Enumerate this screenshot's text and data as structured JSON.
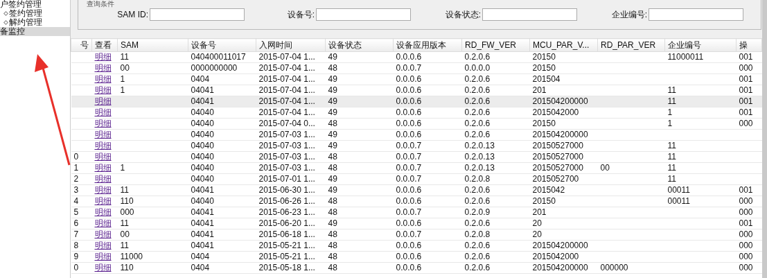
{
  "sidebar": {
    "items": [
      {
        "label": "户签约管理",
        "kind": "group",
        "selected": false
      },
      {
        "label": "签约管理",
        "kind": "leaf",
        "selected": false
      },
      {
        "label": "解约管理",
        "kind": "leaf",
        "selected": false
      },
      {
        "label": "备监控",
        "kind": "group",
        "selected": true
      }
    ]
  },
  "query": {
    "legend": "查询条件",
    "fields": [
      {
        "label": "SAM ID:"
      },
      {
        "label": "设备号:"
      },
      {
        "label": "设备状态:"
      },
      {
        "label": "企业编号:"
      }
    ]
  },
  "table": {
    "columns": [
      "号",
      "查看",
      "SAM",
      "设备号",
      "入网时间",
      "设备状态",
      "设备应用版本",
      "RD_FW_VER",
      "MCU_PAR_V...",
      "RD_PAR_VER",
      "企业编号",
      "操"
    ],
    "rows": [
      {
        "selected": false,
        "cells": [
          "",
          "明细",
          "11",
          "040400011017",
          "2015-07-04 1...",
          "49",
          "0.0.0.6",
          "0.2.0.6",
          "20150",
          "",
          "11000011",
          "001"
        ]
      },
      {
        "selected": false,
        "cells": [
          "",
          "明细",
          "00",
          "0000000000",
          "2015-07-04 1...",
          "48",
          "0.0.0.7",
          "0.0.0.0",
          "20150",
          "",
          "",
          "000"
        ]
      },
      {
        "selected": false,
        "cells": [
          "",
          "明细",
          "1",
          "0404",
          "2015-07-04 1...",
          "49",
          "0.0.0.6",
          "0.2.0.6",
          "201504",
          "",
          "",
          "001"
        ]
      },
      {
        "selected": false,
        "cells": [
          "",
          "明细",
          "1",
          "04041",
          "2015-07-04 1...",
          "49",
          "0.0.0.6",
          "0.2.0.6",
          "201",
          "",
          "11",
          "001"
        ]
      },
      {
        "selected": true,
        "cells": [
          "",
          "明细",
          "",
          "04041",
          "2015-07-04 1...",
          "49",
          "0.0.0.6",
          "0.2.0.6",
          "201504200000",
          "",
          "11",
          "001"
        ]
      },
      {
        "selected": false,
        "cells": [
          "",
          "明细",
          "",
          "04040",
          "2015-07-04 1...",
          "49",
          "0.0.0.6",
          "0.2.0.6",
          "2015042000",
          "",
          "1",
          "001"
        ]
      },
      {
        "selected": false,
        "cells": [
          "",
          "明细",
          "",
          "04040",
          "2015-07-04 0...",
          "48",
          "0.0.0.6",
          "0.2.0.6",
          "20150",
          "",
          "1",
          "000"
        ]
      },
      {
        "selected": false,
        "cells": [
          "",
          "明细",
          "",
          "04040",
          "2015-07-03 1...",
          "49",
          "0.0.0.6",
          "0.2.0.6",
          "201504200000",
          "",
          "",
          ""
        ]
      },
      {
        "selected": false,
        "cells": [
          "",
          "明细",
          "",
          "04040",
          "2015-07-03 1...",
          "49",
          "0.0.0.7",
          "0.2.0.13",
          "20150527000",
          "",
          "11",
          ""
        ]
      },
      {
        "selected": false,
        "cells": [
          "0",
          "明细",
          "",
          "04040",
          "2015-07-03 1...",
          "48",
          "0.0.0.7",
          "0.2.0.13",
          "20150527000",
          "",
          "11",
          ""
        ]
      },
      {
        "selected": false,
        "cells": [
          "1",
          "明细",
          "1",
          "04040",
          "2015-07-03 1...",
          "48",
          "0.0.0.7",
          "0.2.0.13",
          "20150527000",
          "00",
          "11",
          ""
        ]
      },
      {
        "selected": false,
        "cells": [
          "2",
          "明细",
          "",
          "04040",
          "2015-07-01 1...",
          "49",
          "0.0.0.7",
          "0.2.0.8",
          "2015052700",
          "",
          "11",
          ""
        ]
      },
      {
        "selected": false,
        "cells": [
          "3",
          "明细",
          "11",
          "04041",
          "2015-06-30 1...",
          "49",
          "0.0.0.6",
          "0.2.0.6",
          "2015042",
          "",
          "00011",
          "001"
        ]
      },
      {
        "selected": false,
        "cells": [
          "4",
          "明细",
          "110",
          "04040",
          "2015-06-26 1...",
          "48",
          "0.0.0.6",
          "0.2.0.6",
          "20150",
          "",
          "00011",
          "000"
        ]
      },
      {
        "selected": false,
        "cells": [
          "5",
          "明细",
          "000",
          "04041",
          "2015-06-23 1...",
          "48",
          "0.0.0.7",
          "0.2.0.9",
          "201",
          "",
          "",
          "000"
        ]
      },
      {
        "selected": false,
        "cells": [
          "6",
          "明细",
          "11",
          "04041",
          "2015-06-20 1...",
          "49",
          "0.0.0.6",
          "0.2.0.6",
          "20",
          "",
          "",
          "001"
        ]
      },
      {
        "selected": false,
        "cells": [
          "7",
          "明细",
          "00",
          "04041",
          "2015-06-18 1...",
          "48",
          "0.0.0.7",
          "0.2.0.8",
          "20",
          "",
          "",
          "000"
        ]
      },
      {
        "selected": false,
        "cells": [
          "8",
          "明细",
          "11",
          "04041",
          "2015-05-21 1...",
          "48",
          "0.0.0.6",
          "0.2.0.6",
          "201504200000",
          "",
          "",
          "000"
        ]
      },
      {
        "selected": false,
        "cells": [
          "9",
          "明细",
          "11000",
          "0404",
          "2015-05-21 1...",
          "48",
          "0.0.0.6",
          "0.2.0.6",
          "2015042000",
          "",
          "",
          "000"
        ]
      },
      {
        "selected": false,
        "cells": [
          "0",
          "明细",
          "110",
          "0404",
          "2015-05-18 1...",
          "48",
          "0.0.0.6",
          "0.2.0.6",
          "201504200000",
          "000000",
          "",
          "000"
        ]
      }
    ]
  }
}
